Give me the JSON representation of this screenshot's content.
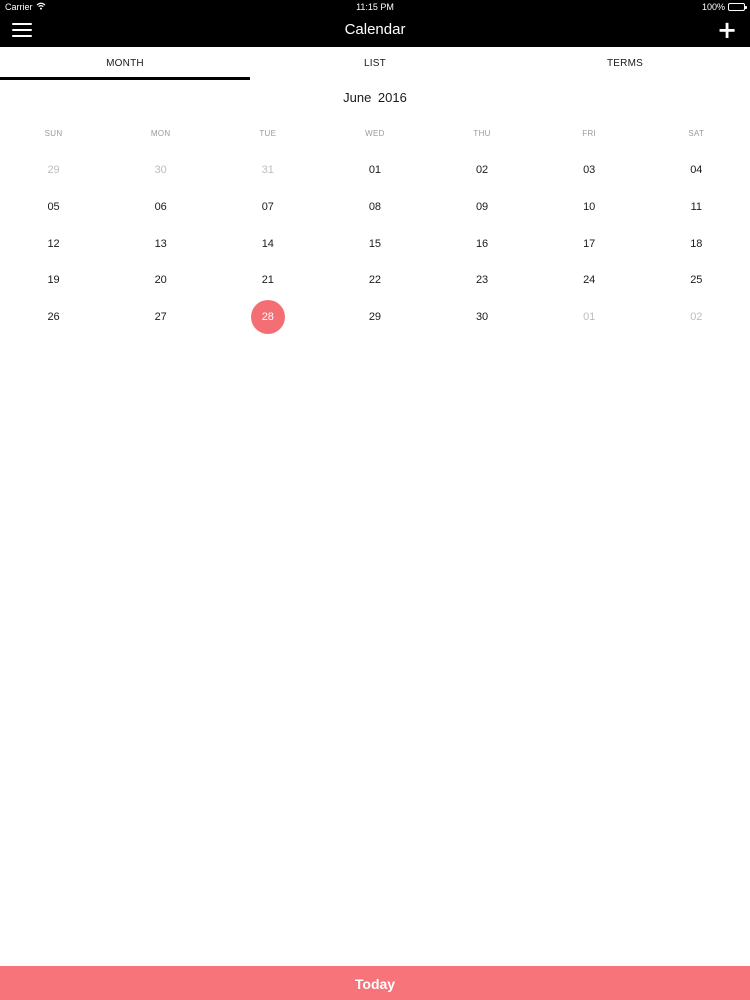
{
  "status_bar": {
    "carrier": "Carrier",
    "time": "11:15 PM",
    "battery": "100%",
    "battery_level": 1.0
  },
  "nav": {
    "title": "Calendar",
    "menu_icon": "hamburger-menu-icon",
    "add_label": "+"
  },
  "tabs": [
    {
      "label": "MONTH",
      "active": true
    },
    {
      "label": "LIST",
      "active": false
    },
    {
      "label": "TERMS",
      "active": false
    }
  ],
  "calendar": {
    "month_title": "June 2016",
    "weekdays": [
      "SUN",
      "MON",
      "TUE",
      "WED",
      "THU",
      "FRI",
      "SAT"
    ],
    "weeks": [
      [
        {
          "d": "29",
          "muted": true
        },
        {
          "d": "30",
          "muted": true
        },
        {
          "d": "31",
          "muted": true
        },
        {
          "d": "01"
        },
        {
          "d": "02"
        },
        {
          "d": "03"
        },
        {
          "d": "04"
        }
      ],
      [
        {
          "d": "05"
        },
        {
          "d": "06"
        },
        {
          "d": "07"
        },
        {
          "d": "08"
        },
        {
          "d": "09"
        },
        {
          "d": "10"
        },
        {
          "d": "11"
        }
      ],
      [
        {
          "d": "12"
        },
        {
          "d": "13"
        },
        {
          "d": "14"
        },
        {
          "d": "15"
        },
        {
          "d": "16"
        },
        {
          "d": "17"
        },
        {
          "d": "18"
        }
      ],
      [
        {
          "d": "19"
        },
        {
          "d": "20"
        },
        {
          "d": "21"
        },
        {
          "d": "22"
        },
        {
          "d": "23"
        },
        {
          "d": "24"
        },
        {
          "d": "25"
        }
      ],
      [
        {
          "d": "26"
        },
        {
          "d": "27"
        },
        {
          "d": "28",
          "today": true
        },
        {
          "d": "29"
        },
        {
          "d": "30"
        },
        {
          "d": "01",
          "muted": true
        },
        {
          "d": "02",
          "muted": true
        }
      ]
    ]
  },
  "footer": {
    "today_label": "Today"
  },
  "colors": {
    "accent": "#f36f73",
    "bar": "#000000",
    "muted_text": "#bdbdbd"
  }
}
